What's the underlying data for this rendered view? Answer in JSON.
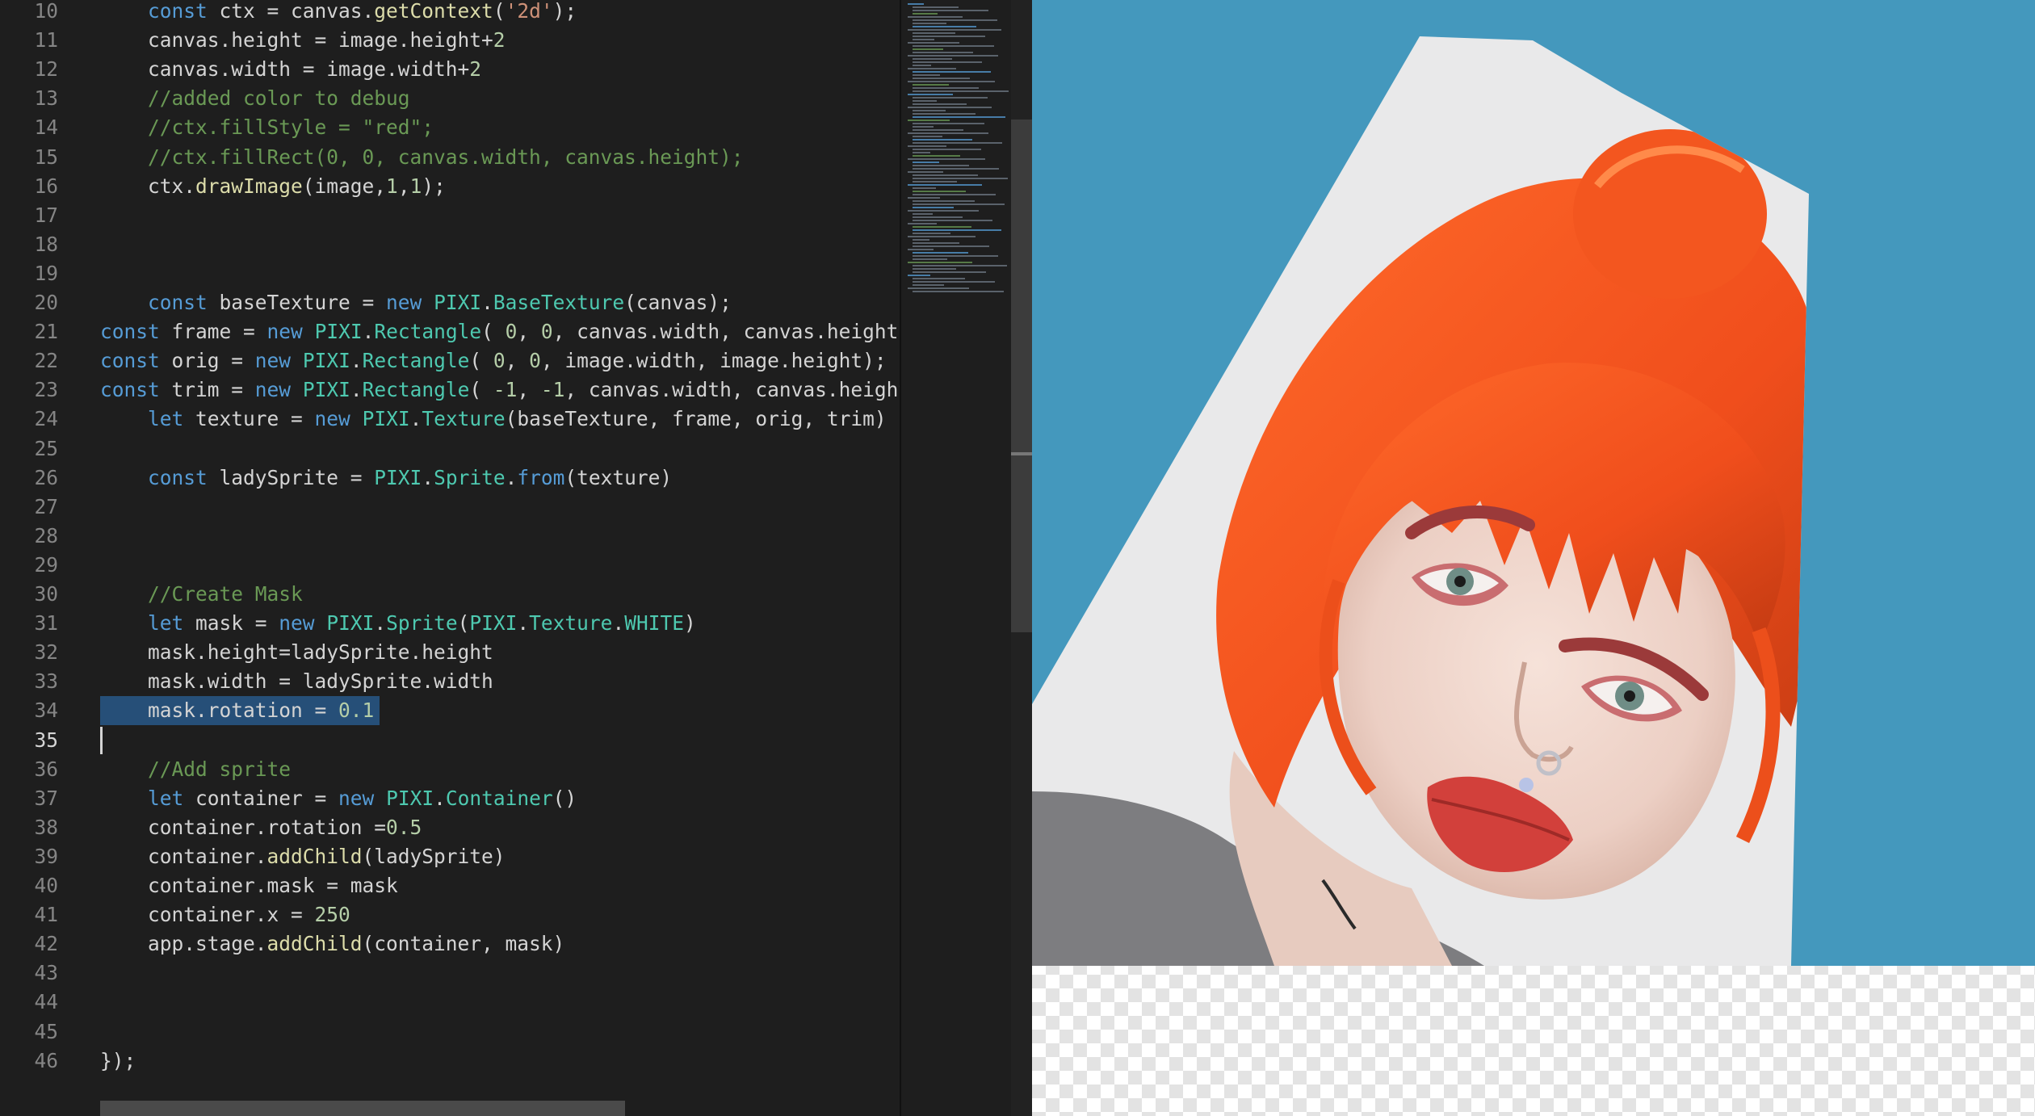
{
  "editor": {
    "lines": [
      {
        "n": "10",
        "tokens": [
          {
            "t": "    "
          },
          {
            "t": "const",
            "c": "kw"
          },
          {
            "t": " ctx = canvas."
          },
          {
            "t": "getContext",
            "c": "fn"
          },
          {
            "t": "("
          },
          {
            "t": "'2d'",
            "c": "str"
          },
          {
            "t": ");"
          }
        ]
      },
      {
        "n": "11",
        "tokens": [
          {
            "t": "    canvas.height = image.height+"
          },
          {
            "t": "2",
            "c": "num"
          }
        ]
      },
      {
        "n": "12",
        "tokens": [
          {
            "t": "    canvas.width = image.width+"
          },
          {
            "t": "2",
            "c": "num"
          }
        ]
      },
      {
        "n": "13",
        "tokens": [
          {
            "t": "    "
          },
          {
            "t": "//added color to debug",
            "c": "cmt"
          }
        ]
      },
      {
        "n": "14",
        "tokens": [
          {
            "t": "    "
          },
          {
            "t": "//ctx.fillStyle = \"red\";",
            "c": "cmt"
          }
        ]
      },
      {
        "n": "15",
        "tokens": [
          {
            "t": "    "
          },
          {
            "t": "//ctx.fillRect(0, 0, canvas.width, canvas.height);",
            "c": "cmt"
          }
        ]
      },
      {
        "n": "16",
        "tokens": [
          {
            "t": "    ctx."
          },
          {
            "t": "drawImage",
            "c": "fn"
          },
          {
            "t": "(image,"
          },
          {
            "t": "1",
            "c": "num"
          },
          {
            "t": ","
          },
          {
            "t": "1",
            "c": "num"
          },
          {
            "t": ");"
          }
        ]
      },
      {
        "n": "17",
        "tokens": []
      },
      {
        "n": "18",
        "tokens": []
      },
      {
        "n": "19",
        "tokens": []
      },
      {
        "n": "20",
        "tokens": [
          {
            "t": "    "
          },
          {
            "t": "const",
            "c": "kw"
          },
          {
            "t": " baseTexture = "
          },
          {
            "t": "new",
            "c": "kw"
          },
          {
            "t": " "
          },
          {
            "t": "PIXI",
            "c": "cls"
          },
          {
            "t": "."
          },
          {
            "t": "BaseTexture",
            "c": "cls"
          },
          {
            "t": "(canvas);"
          }
        ]
      },
      {
        "n": "21",
        "tokens": [
          {
            "t": "const",
            "c": "kw"
          },
          {
            "t": " frame = "
          },
          {
            "t": "new",
            "c": "kw"
          },
          {
            "t": " "
          },
          {
            "t": "PIXI",
            "c": "cls"
          },
          {
            "t": "."
          },
          {
            "t": "Rectangle",
            "c": "cls"
          },
          {
            "t": "( "
          },
          {
            "t": "0",
            "c": "num"
          },
          {
            "t": ", "
          },
          {
            "t": "0",
            "c": "num"
          },
          {
            "t": ", canvas.width, canvas.height);"
          }
        ]
      },
      {
        "n": "22",
        "tokens": [
          {
            "t": "const",
            "c": "kw"
          },
          {
            "t": " orig = "
          },
          {
            "t": "new",
            "c": "kw"
          },
          {
            "t": " "
          },
          {
            "t": "PIXI",
            "c": "cls"
          },
          {
            "t": "."
          },
          {
            "t": "Rectangle",
            "c": "cls"
          },
          {
            "t": "( "
          },
          {
            "t": "0",
            "c": "num"
          },
          {
            "t": ", "
          },
          {
            "t": "0",
            "c": "num"
          },
          {
            "t": ", image.width, image.height);"
          }
        ]
      },
      {
        "n": "23",
        "tokens": [
          {
            "t": "const",
            "c": "kw"
          },
          {
            "t": " trim = "
          },
          {
            "t": "new",
            "c": "kw"
          },
          {
            "t": " "
          },
          {
            "t": "PIXI",
            "c": "cls"
          },
          {
            "t": "."
          },
          {
            "t": "Rectangle",
            "c": "cls"
          },
          {
            "t": "( "
          },
          {
            "t": "-1",
            "c": "num"
          },
          {
            "t": ", "
          },
          {
            "t": "-1",
            "c": "num"
          },
          {
            "t": ", canvas.width, canvas.height)"
          }
        ]
      },
      {
        "n": "24",
        "tokens": [
          {
            "t": "    "
          },
          {
            "t": "let",
            "c": "kw"
          },
          {
            "t": " texture = "
          },
          {
            "t": "new",
            "c": "kw"
          },
          {
            "t": " "
          },
          {
            "t": "PIXI",
            "c": "cls"
          },
          {
            "t": "."
          },
          {
            "t": "Texture",
            "c": "cls"
          },
          {
            "t": "(baseTexture, frame, orig, trim)"
          }
        ]
      },
      {
        "n": "25",
        "tokens": []
      },
      {
        "n": "26",
        "tokens": [
          {
            "t": "    "
          },
          {
            "t": "const",
            "c": "kw"
          },
          {
            "t": " ladySprite = "
          },
          {
            "t": "PIXI",
            "c": "cls"
          },
          {
            "t": "."
          },
          {
            "t": "Sprite",
            "c": "cls"
          },
          {
            "t": "."
          },
          {
            "t": "from",
            "c": "kw"
          },
          {
            "t": "(texture)"
          }
        ]
      },
      {
        "n": "27",
        "tokens": []
      },
      {
        "n": "28",
        "tokens": []
      },
      {
        "n": "29",
        "tokens": []
      },
      {
        "n": "30",
        "tokens": [
          {
            "t": "    "
          },
          {
            "t": "//Create Mask",
            "c": "cmt"
          }
        ]
      },
      {
        "n": "31",
        "tokens": [
          {
            "t": "    "
          },
          {
            "t": "let",
            "c": "kw"
          },
          {
            "t": " mask = "
          },
          {
            "t": "new",
            "c": "kw"
          },
          {
            "t": " "
          },
          {
            "t": "PIXI",
            "c": "cls"
          },
          {
            "t": "."
          },
          {
            "t": "Sprite",
            "c": "cls"
          },
          {
            "t": "("
          },
          {
            "t": "PIXI",
            "c": "cls"
          },
          {
            "t": "."
          },
          {
            "t": "Texture",
            "c": "cls"
          },
          {
            "t": "."
          },
          {
            "t": "WHITE",
            "c": "cls"
          },
          {
            "t": ")"
          }
        ]
      },
      {
        "n": "32",
        "tokens": [
          {
            "t": "    mask.height=ladySprite.height"
          }
        ]
      },
      {
        "n": "33",
        "tokens": [
          {
            "t": "    mask.width = ladySprite.width"
          }
        ]
      },
      {
        "n": "34",
        "tokens": [
          {
            "t": "    mask.rotation = "
          },
          {
            "t": "0.1",
            "c": "num"
          }
        ]
      },
      {
        "n": "35",
        "tokens": []
      },
      {
        "n": "36",
        "tokens": [
          {
            "t": "    "
          },
          {
            "t": "//Add sprite",
            "c": "cmt"
          }
        ]
      },
      {
        "n": "37",
        "tokens": [
          {
            "t": "    "
          },
          {
            "t": "let",
            "c": "kw"
          },
          {
            "t": " container = "
          },
          {
            "t": "new",
            "c": "kw"
          },
          {
            "t": " "
          },
          {
            "t": "PIXI",
            "c": "cls"
          },
          {
            "t": "."
          },
          {
            "t": "Container",
            "c": "cls"
          },
          {
            "t": "()"
          }
        ]
      },
      {
        "n": "38",
        "tokens": [
          {
            "t": "    container.rotation ="
          },
          {
            "t": "0.5",
            "c": "num"
          }
        ]
      },
      {
        "n": "39",
        "tokens": [
          {
            "t": "    container."
          },
          {
            "t": "addChild",
            "c": "fn"
          },
          {
            "t": "(ladySprite)"
          }
        ]
      },
      {
        "n": "40",
        "tokens": [
          {
            "t": "    container.mask = mask"
          }
        ]
      },
      {
        "n": "41",
        "tokens": [
          {
            "t": "    container.x = "
          },
          {
            "t": "250",
            "c": "num"
          }
        ]
      },
      {
        "n": "42",
        "tokens": [
          {
            "t": "    app.stage."
          },
          {
            "t": "addChild",
            "c": "fn"
          },
          {
            "t": "(container, mask)"
          }
        ]
      },
      {
        "n": "43",
        "tokens": []
      },
      {
        "n": "44",
        "tokens": []
      },
      {
        "n": "45",
        "tokens": []
      },
      {
        "n": "46",
        "tokens": [
          {
            "t": "});"
          }
        ]
      }
    ],
    "selected_line": "34",
    "cursor_line": "35"
  },
  "colors": {
    "editor_bg": "#1e1e1e",
    "keyword": "#569cd6",
    "class": "#4ec9b0",
    "function": "#dcdcaa",
    "number": "#b5cea8",
    "string": "#ce9178",
    "comment": "#6a9955",
    "selection": "#264f78",
    "stage_bg": "#4498bd"
  },
  "preview": {
    "image_subject": "portrait photo of a woman with orange hair, rotated and clipped by a rotated mask",
    "transparent_area": "checkerboard"
  }
}
